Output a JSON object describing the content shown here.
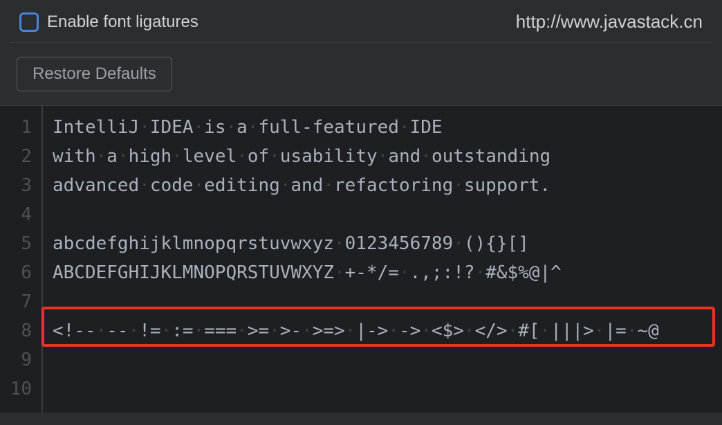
{
  "header": {
    "checkboxLabel": "Enable font ligatures",
    "watermark": "http://www.javastack.cn"
  },
  "toolbar": {
    "restoreLabel": "Restore Defaults"
  },
  "editor": {
    "lines": [
      "IntelliJ IDEA is a full-featured IDE",
      "with a high level of usability and outstanding",
      "advanced code editing and refactoring support.",
      "",
      "abcdefghijklmnopqrstuvwxyz 0123456789 (){}[]",
      "ABCDEFGHIJKLMNOPQRSTUVWXYZ +-*/= .,;:!? #&$%@|^",
      "",
      "<!-- -- != := === >= >- >=> |-> -> <$> </> #[ |||> |= ~@",
      "",
      ""
    ]
  }
}
